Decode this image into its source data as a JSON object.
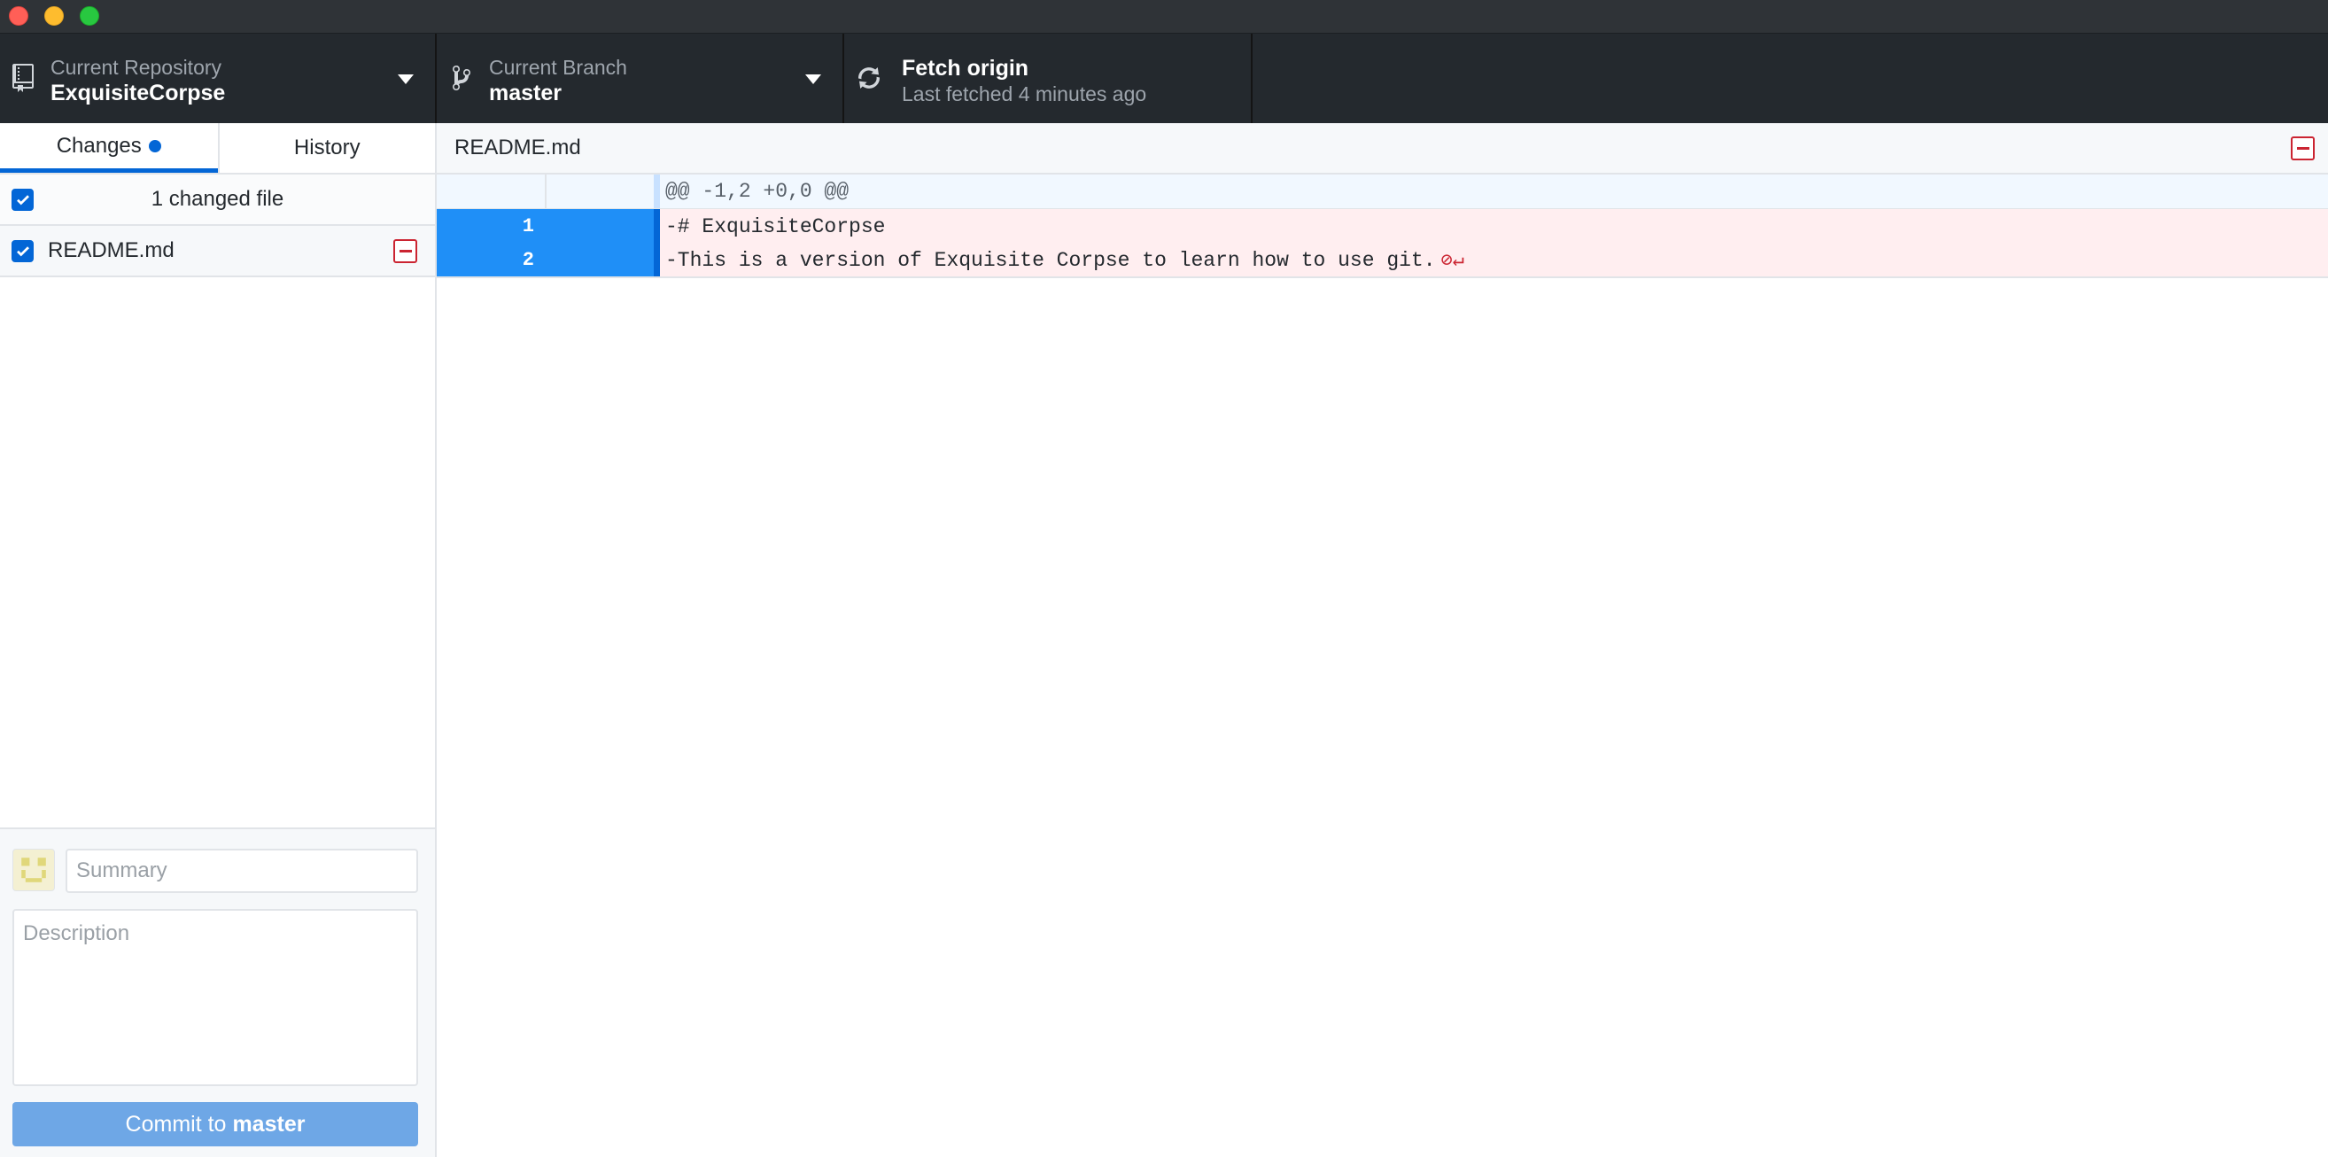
{
  "toolbar": {
    "repository": {
      "label": "Current Repository",
      "value": "ExquisiteCorpse"
    },
    "branch": {
      "label": "Current Branch",
      "value": "master"
    },
    "fetch": {
      "title": "Fetch origin",
      "subtitle": "Last fetched 4 minutes ago"
    }
  },
  "sidebar": {
    "tabs": [
      {
        "label": "Changes",
        "active": true,
        "has_changes": true
      },
      {
        "label": "History",
        "active": false
      }
    ],
    "changes_header": "1 changed file",
    "files": [
      {
        "name": "README.md",
        "checked": true,
        "status": "deleted"
      }
    ]
  },
  "commit": {
    "summary_placeholder": "Summary",
    "description_placeholder": "Description",
    "button_prefix": "Commit to",
    "button_branch": "master"
  },
  "diff": {
    "file_path": "README.md",
    "hunk_header": "@@ -1,2 +0,0 @@",
    "lines": [
      {
        "old": "1",
        "new": "",
        "text": "-# ExquisiteCorpse"
      },
      {
        "old": "2",
        "new": "",
        "text": "-This is a version of Exquisite Corpse to learn how to use git.",
        "no_newline_glyph": "⊘↵"
      }
    ]
  },
  "colors": {
    "accent": "#0366d6",
    "deleted": "#cb2431",
    "deleted_bg": "#ffeef0",
    "toolbar_bg": "#24292e",
    "commit_button": "#6ea7e6"
  }
}
